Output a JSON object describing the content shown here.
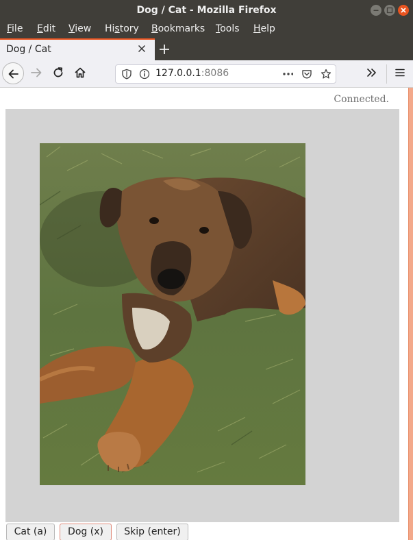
{
  "window": {
    "title": "Dog / Cat - Mozilla Firefox",
    "accent_color": "#e95420"
  },
  "menu": {
    "items": [
      {
        "accel": "F",
        "rest": "ile"
      },
      {
        "accel": "E",
        "rest": "dit"
      },
      {
        "accel": "V",
        "rest": "iew"
      },
      {
        "accel": "",
        "pre": "Hi",
        "accel2": "s",
        "rest": "tory"
      },
      {
        "accel": "B",
        "rest": "ookmarks"
      },
      {
        "accel": "T",
        "rest": "ools"
      },
      {
        "accel": "H",
        "rest": "elp"
      }
    ]
  },
  "tab": {
    "title": "Dog / Cat"
  },
  "urlbar": {
    "host": "127.0.0.1",
    "port": ":8086"
  },
  "page": {
    "status": "Connected.",
    "image_alt": "dog-photo",
    "buttons": {
      "cat": "Cat (a)",
      "dog": "Dog (x)",
      "skip": "Skip (enter)"
    },
    "panel_color": "#d3d3d3"
  }
}
